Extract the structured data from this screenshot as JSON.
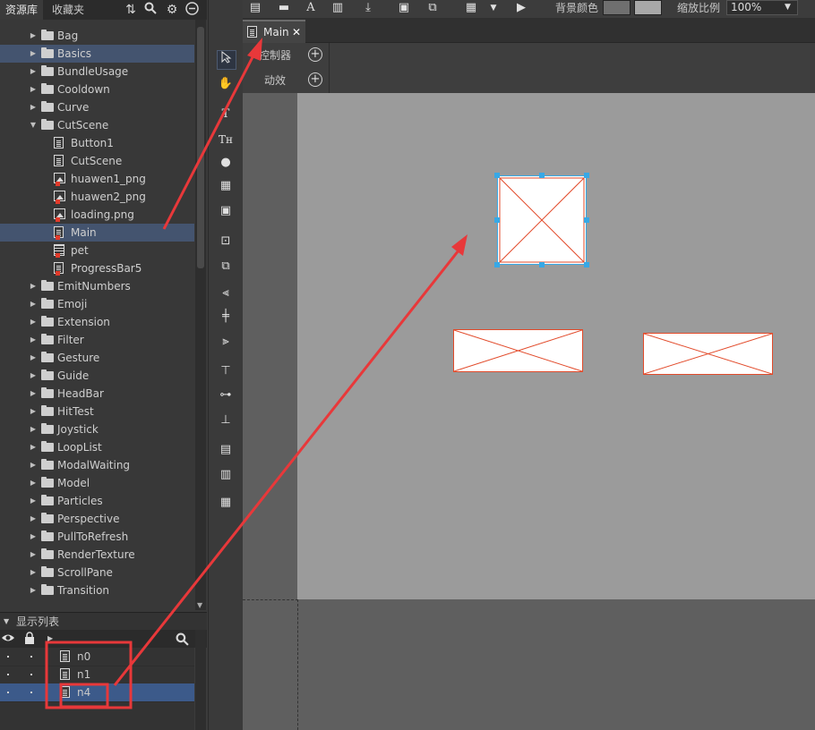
{
  "library": {
    "tabs": [
      "资源库",
      "收藏夹"
    ],
    "tools": [
      "refresh-icon",
      "search-icon",
      "gear-icon",
      "minus-circle-icon"
    ],
    "items": [
      {
        "label": "Bag",
        "type": "folder",
        "level": 0,
        "selected": false
      },
      {
        "label": "Basics",
        "type": "folder",
        "level": 0,
        "selected": true
      },
      {
        "label": "BundleUsage",
        "type": "folder",
        "level": 0,
        "selected": false
      },
      {
        "label": "Cooldown",
        "type": "folder",
        "level": 0,
        "selected": false
      },
      {
        "label": "Curve",
        "type": "folder",
        "level": 0,
        "selected": false
      },
      {
        "label": "CutScene",
        "type": "folder-open",
        "level": 0,
        "selected": false
      },
      {
        "label": "Button1",
        "type": "component",
        "level": 1,
        "selected": false
      },
      {
        "label": "CutScene",
        "type": "component",
        "level": 1,
        "selected": false
      },
      {
        "label": "huawen1_png",
        "type": "image-export",
        "level": 1,
        "selected": false
      },
      {
        "label": "huawen2_png",
        "type": "image-export",
        "level": 1,
        "selected": false
      },
      {
        "label": "loading.png",
        "type": "image-export",
        "level": 1,
        "selected": false
      },
      {
        "label": "Main",
        "type": "component-export",
        "level": 1,
        "selected": true
      },
      {
        "label": "pet",
        "type": "movieclip-export",
        "level": 1,
        "selected": false
      },
      {
        "label": "ProgressBar5",
        "type": "component-export",
        "level": 1,
        "selected": false
      },
      {
        "label": "EmitNumbers",
        "type": "folder",
        "level": 0,
        "selected": false
      },
      {
        "label": "Emoji",
        "type": "folder",
        "level": 0,
        "selected": false
      },
      {
        "label": "Extension",
        "type": "folder",
        "level": 0,
        "selected": false
      },
      {
        "label": "Filter",
        "type": "folder",
        "level": 0,
        "selected": false
      },
      {
        "label": "Gesture",
        "type": "folder",
        "level": 0,
        "selected": false
      },
      {
        "label": "Guide",
        "type": "folder",
        "level": 0,
        "selected": false
      },
      {
        "label": "HeadBar",
        "type": "folder",
        "level": 0,
        "selected": false
      },
      {
        "label": "HitTest",
        "type": "folder",
        "level": 0,
        "selected": false
      },
      {
        "label": "Joystick",
        "type": "folder",
        "level": 0,
        "selected": false
      },
      {
        "label": "LoopList",
        "type": "folder",
        "level": 0,
        "selected": false
      },
      {
        "label": "ModalWaiting",
        "type": "folder",
        "level": 0,
        "selected": false
      },
      {
        "label": "Model",
        "type": "folder",
        "level": 0,
        "selected": false
      },
      {
        "label": "Particles",
        "type": "folder",
        "level": 0,
        "selected": false
      },
      {
        "label": "Perspective",
        "type": "folder",
        "level": 0,
        "selected": false
      },
      {
        "label": "PullToRefresh",
        "type": "folder",
        "level": 0,
        "selected": false
      },
      {
        "label": "RenderTexture",
        "type": "folder",
        "level": 0,
        "selected": false
      },
      {
        "label": "ScrollPane",
        "type": "folder",
        "level": 0,
        "selected": false
      },
      {
        "label": "Transition",
        "type": "folder",
        "level": 0,
        "selected": false
      }
    ]
  },
  "display_list": {
    "title": "显示列表",
    "items": [
      {
        "label": "n0",
        "selected": false
      },
      {
        "label": "n1",
        "selected": false
      },
      {
        "label": "n4",
        "selected": true
      }
    ]
  },
  "toolbar": {
    "bg_color_label": "背景颜色",
    "zoom_label": "缩放比例",
    "zoom_value": "100%",
    "bg_color_1": "#6f6f6f",
    "bg_color_2": "#a8a8a8"
  },
  "doc": {
    "tab_label": "Main",
    "controller_label": "控制器",
    "transition_label": "动效"
  },
  "colors": {
    "accent_selection": "#44546f",
    "handle": "#37a8e6",
    "annotation": "#e8383a"
  }
}
